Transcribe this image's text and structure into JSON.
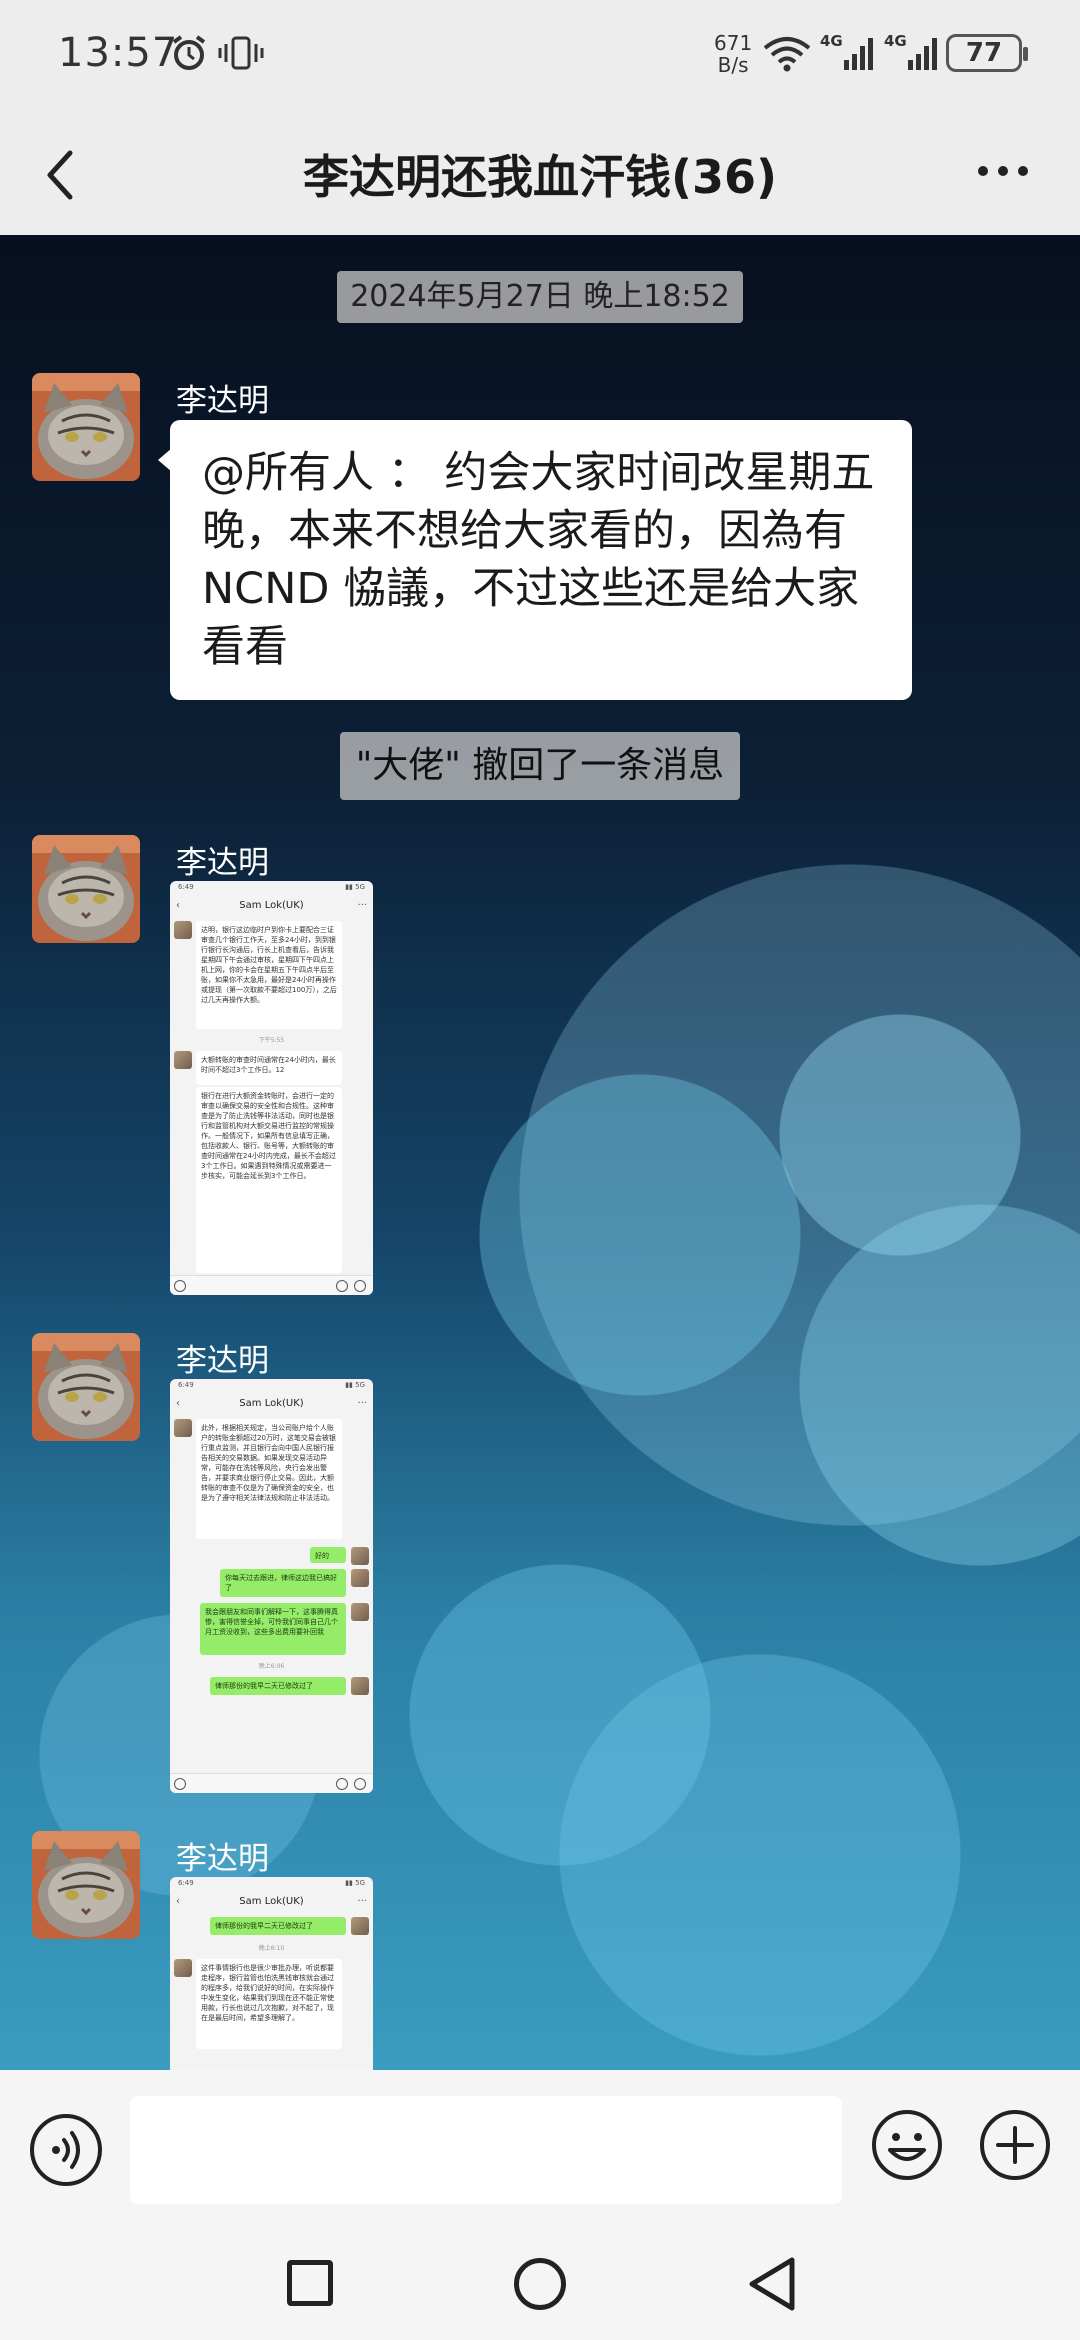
{
  "status_bar": {
    "time": "13:57",
    "net_speed_value": "671",
    "net_speed_unit": "B/s",
    "signal1": "4G",
    "signal2": "4G",
    "battery": "77"
  },
  "header": {
    "title": "李达明还我血汗钱(36)"
  },
  "chat": {
    "timestamp": "2024年5月27日 晚上18:52",
    "recall_notice": "\"大佬\" 撤回了一条消息",
    "messages": [
      {
        "sender": "李达明",
        "type": "text",
        "text": "@所有人 ： 约会大家时间改星期五晚，本来不想给大家看的，因為有 NCND 恊議，不过这些还是给大家看看"
      },
      {
        "sender": "李达明",
        "type": "image",
        "shot_title": "Sam Lok(UK)",
        "blocks": [
          "达明，银行这边临时户到你卡上要配合三证审查几个银行工作天，至多24小时，到到银行银行长沟通后，行长上机查看后，告诉我星期四下午会通过审核，星期四下午四点上机上网，你的卡会在星期五下午四点半后至账，如果你不太急用，最好是24小时再操作或提现（第一次取款不要超过100万），之后过几天再操作大额。",
          "大额转账的审查时间通常在24小时内，最长时间不超过3个工作日。12",
          "银行在进行大额资金转账时，会进行一定的审查以确保交易的安全性和合规性。这种审查是为了防止洗钱等非法活动，同时也是银行和监管机构对大额交易进行监控的常规操作。一般情况下，如果所有信息填写正确，包括收款人、银行、账号等，大额转账的审查时间通常在24小时内完成，最长不会超过3个工作日。如果遇到特殊情况或需要进一步核实，可能会延长到3个工作日。"
        ],
        "mid_time": "下午5:55"
      },
      {
        "sender": "李达明",
        "type": "image",
        "shot_title": "Sam Lok(UK)",
        "blocks": [
          "此外，根据相关规定，当公司账户给个人账户的转账金额超过20万时，这笔交易会被银行重点监测，并且银行会向中国人民银行报告相关的交易数据。如果发现交易活动异常，可能存在洗钱等风险，央行会发出警告，并要求商业银行停止交易。因此，大额转账的审查不仅是为了确保资金的安全，也是为了遵守相关法律法规和防止非法活动。",
          "好的",
          "你每天过去跟进，律师这边我已搞好了",
          "我会跟朋友和同事们解释一下，这事腾得真惨，害得信誉全掉，可怜我们同事自己几个月工资没收到，这些多出费用要补回我",
          "律师那份的我早二天已修改过了"
        ],
        "mid_time": "晚上6:06"
      },
      {
        "sender": "李达明",
        "type": "image",
        "shot_title": "Sam Lok(UK)",
        "blocks": [
          "律师那份的我早二天已修改过了",
          "这件事情银行也是很少审批办理，听说都要走程序，银行监管也怕洗黑钱审核就会通过的程序多，给我们说好的时间，在实际操作中发生变化，结果我们到现在还不能正常使用款，行长也说过几次抱歉，对不起了，现在是最后时间，希望多理解了。"
        ],
        "mid_time": "晚上6:10"
      }
    ]
  },
  "input_bar": {
    "placeholder": ""
  },
  "colors": {
    "bar_bg": "#ededed",
    "bubble_bg": "#ffffff",
    "wechat_green": "#95ec69",
    "chip_bg": "#c8c8c8"
  }
}
